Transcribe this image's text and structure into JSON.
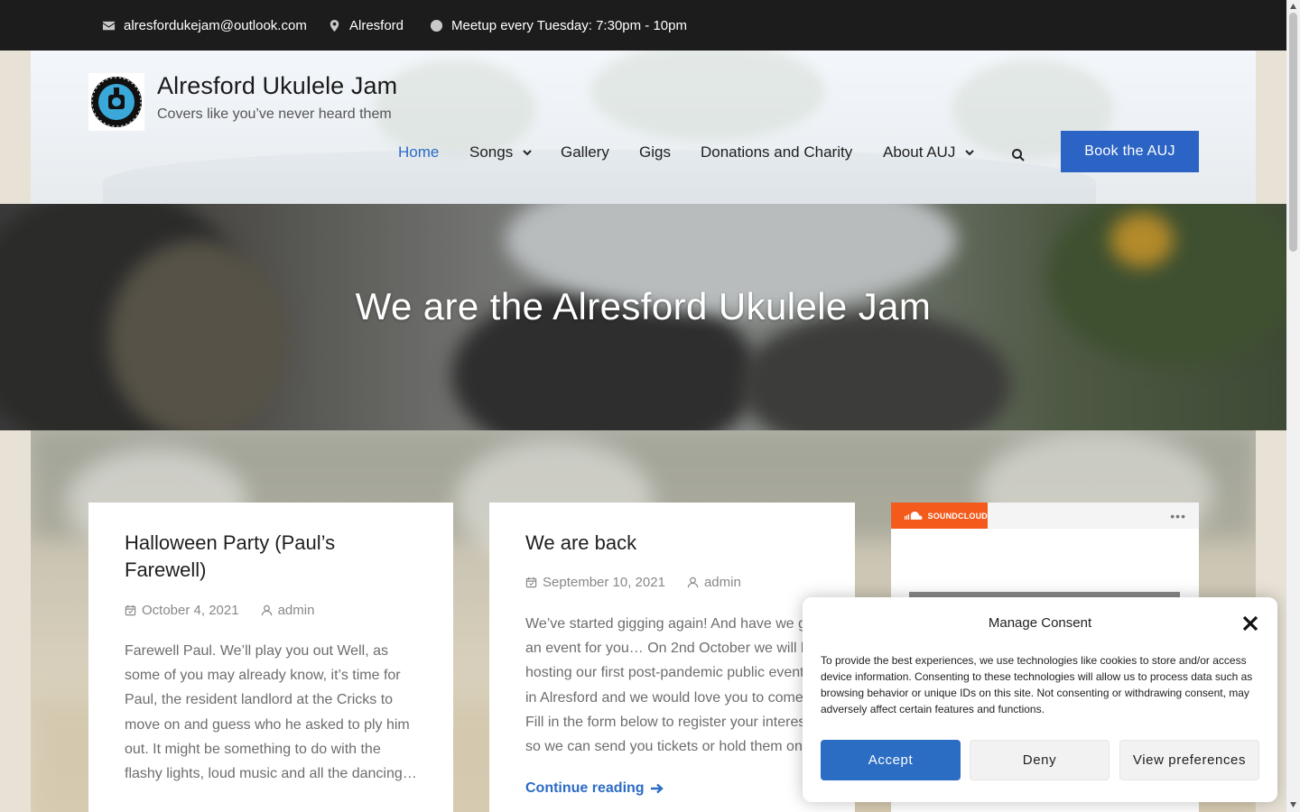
{
  "topbar": {
    "email": "alresfordukejam@outlook.com",
    "location": "Alresford",
    "meetup": "Meetup every Tuesday: 7:30pm - 10pm"
  },
  "site": {
    "title": "Alresford Ukulele Jam",
    "tagline": "Covers like you’ve never heard them",
    "logo_text": "ALRESFORD UKULELE JAM"
  },
  "nav": {
    "items": [
      {
        "label": "Home",
        "active": true
      },
      {
        "label": "Songs",
        "dropdown": true
      },
      {
        "label": "Gallery"
      },
      {
        "label": "Gigs"
      },
      {
        "label": "Donations and Charity"
      },
      {
        "label": "About AUJ",
        "dropdown": true
      }
    ],
    "cta": "Book the AUJ"
  },
  "hero": {
    "title": "We are the Alresford Ukulele Jam"
  },
  "posts": [
    {
      "title": "Halloween Party (Paul’s Farewell)",
      "date": "October 4, 2021",
      "author": "admin",
      "excerpt": "Farewell Paul. We’ll play you out Well, as\nsome of you may already know, it’s time for\nPaul, the resident landlord at the Cricks to\nmove on and guess who he asked to ply him\nout. It might be something to do with the\nflashy lights, loud music and all the dancing…"
    },
    {
      "title": "We are back",
      "date": "September 10, 2021",
      "author": "admin",
      "excerpt": "We’ve started gigging again! And have we g\nan event for you… On 2nd October we will be\nhosting our first post-pandemic public event\nin Alresford and we would love you to come\nFill in the form below to register your interes\nso we can send you tickets or hold them on",
      "more": "Continue reading"
    }
  ],
  "soundcloud": {
    "badge": "SOUNDCLOUD",
    "menu": "•••"
  },
  "consent": {
    "title": "Manage Consent",
    "text": "To provide the best experiences, we use technologies like cookies to store and/or access device information. Consenting to these technologies will allow us to process data such as browsing behavior or unique IDs on this site. Not consenting or withdrawing consent, may adversely affect certain features and functions.",
    "accept": "Accept",
    "deny": "Deny",
    "preferences": "View preferences"
  },
  "colors": {
    "accent": "#2c64c6",
    "topbar": "#1c1c1c",
    "soundcloud": "#f35a1c"
  }
}
